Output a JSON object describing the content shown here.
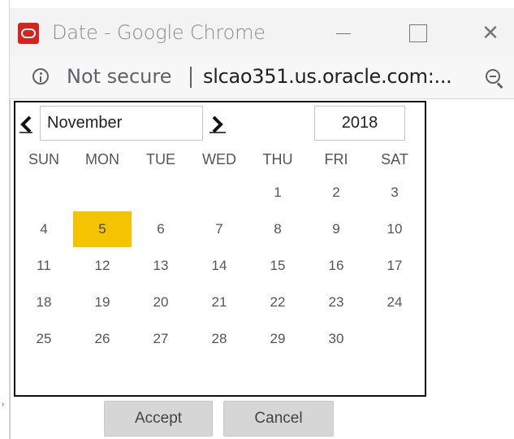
{
  "window": {
    "title": "Date - Google Chrome",
    "icon": "oracle-logo-icon"
  },
  "addressbar": {
    "security_label": "Not secure",
    "url": "slcao351.us.oracle.com:..."
  },
  "calendar": {
    "month": "November",
    "year": "2018",
    "weekdays": [
      "SUN",
      "MON",
      "TUE",
      "WED",
      "THU",
      "FRI",
      "SAT"
    ],
    "days": [
      [
        "",
        "",
        "",
        "",
        "1",
        "2",
        "3"
      ],
      [
        "4",
        "5",
        "6",
        "7",
        "8",
        "9",
        "10"
      ],
      [
        "11",
        "12",
        "13",
        "14",
        "15",
        "16",
        "17"
      ],
      [
        "18",
        "19",
        "20",
        "21",
        "22",
        "23",
        "24"
      ],
      [
        "25",
        "26",
        "27",
        "28",
        "29",
        "30",
        ""
      ]
    ],
    "selected_day": "5",
    "selected_color": "#f5c400"
  },
  "buttons": {
    "accept": "Accept",
    "cancel": "Cancel"
  }
}
